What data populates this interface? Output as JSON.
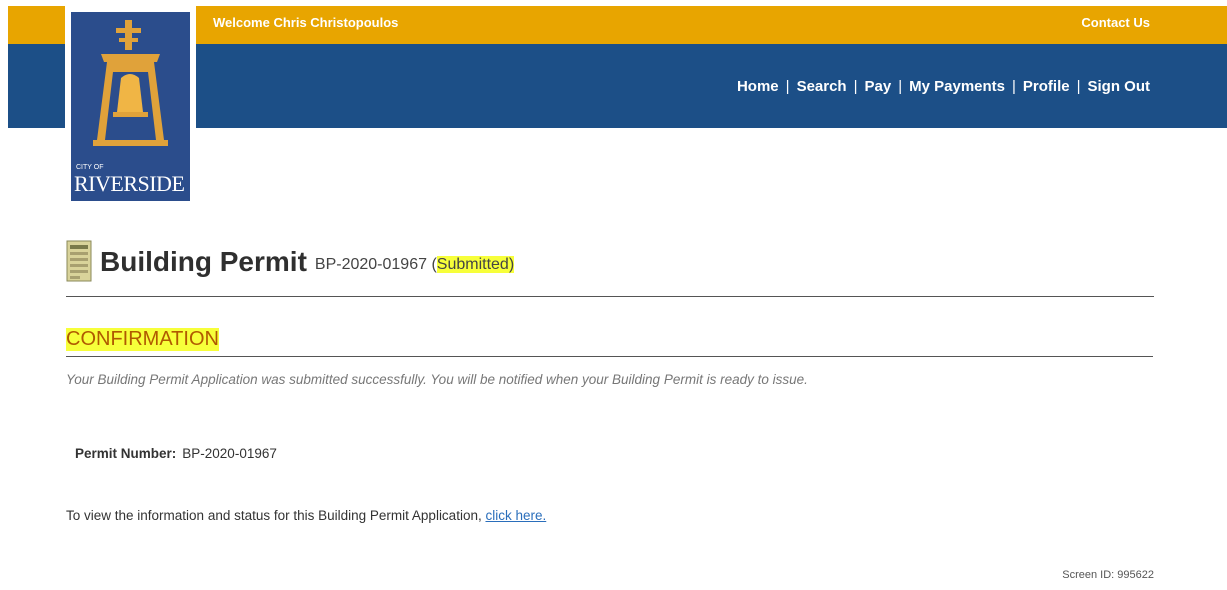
{
  "header": {
    "welcome": "Welcome Chris Christopoulos",
    "contact": "Contact Us",
    "nav": [
      "Home",
      "Search",
      "Pay",
      "My Payments",
      "Profile",
      "Sign Out"
    ],
    "separator": "|"
  },
  "logo": {
    "city": "CITY OF",
    "name": "RIVERSIDE"
  },
  "page": {
    "title": "Building Permit",
    "permit_id": "BP-2020-01967",
    "status_open": "(",
    "status": "Submitted)"
  },
  "confirmation": {
    "heading": "CONFIRMATION",
    "message": "Your Building Permit Application was submitted successfully. You will be notified when your Building Permit is ready to issue.",
    "permit_label": "Permit Number:",
    "permit_value": "BP-2020-01967",
    "view_text": "To view the information and status for this Building Permit Application, ",
    "view_link": "click here."
  },
  "footer": {
    "screen_id": "Screen ID: 995622"
  },
  "colors": {
    "top_bar": "#e8a500",
    "nav_bar": "#1c4f87",
    "highlight": "#f7ff3a",
    "heading": "#b05a00",
    "link": "#2a6ebb"
  }
}
